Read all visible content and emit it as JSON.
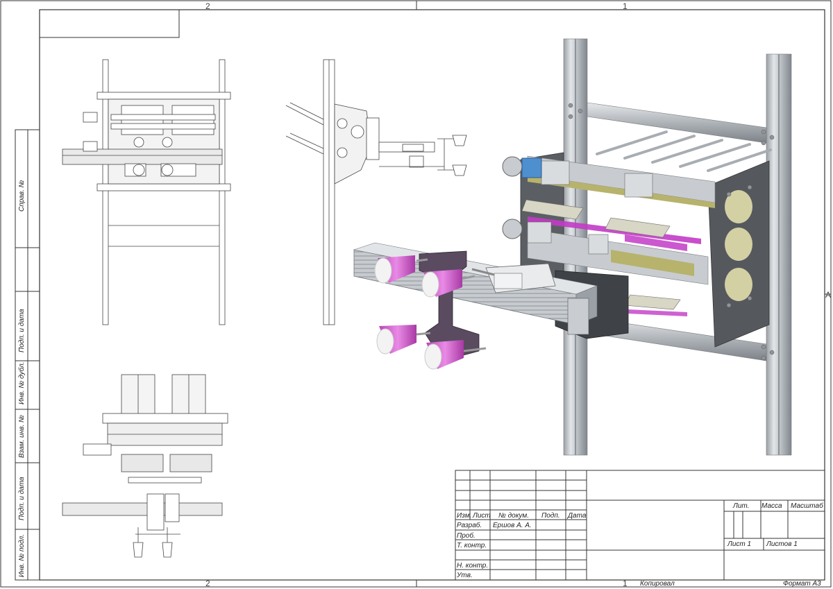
{
  "frame": {
    "zone_top_left": "2",
    "zone_top_right": "1",
    "zone_bottom_left": "2",
    "zone_bottom_right": "1",
    "zone_right": "A"
  },
  "side_strip": {
    "sprav_no": "Справ. №",
    "podp_data_1": "Подп. и дата",
    "inv_dubl": "Инв. № дубл.",
    "vzam_inv": "Взам. инв. №",
    "podp_data_2": "Подп. и дата",
    "inv_podl": "Инв. № подл."
  },
  "title_block": {
    "col_izm": "Изм.",
    "col_list": "Лист",
    "col_doc": "№ докум.",
    "col_podp": "Подп.",
    "col_data": "Дата",
    "razrab": "Разраб.",
    "razrab_name": "Ершов А. А.",
    "prov": "Проб.",
    "t_kontr": "Т. контр.",
    "n_kontr": "Н. контр.",
    "utv": "Утв.",
    "lit": "Лит.",
    "massa": "Масса",
    "masshtab": "Масштаб",
    "list": "Лист 1",
    "listov": "Листов 1"
  },
  "footer": {
    "kopiroval": "Копировал",
    "format": "Формат A3"
  },
  "colors": {
    "line": "#333333",
    "aluminum": "#c9ccd0",
    "aluminum_dark": "#8e9399",
    "plate": "#4a4d52",
    "cup": "#d65fd2",
    "cup_inner": "#f2f2f2",
    "magenta": "#c23bc7",
    "olive": "#b8b56a",
    "blue": "#3b7fc4"
  }
}
